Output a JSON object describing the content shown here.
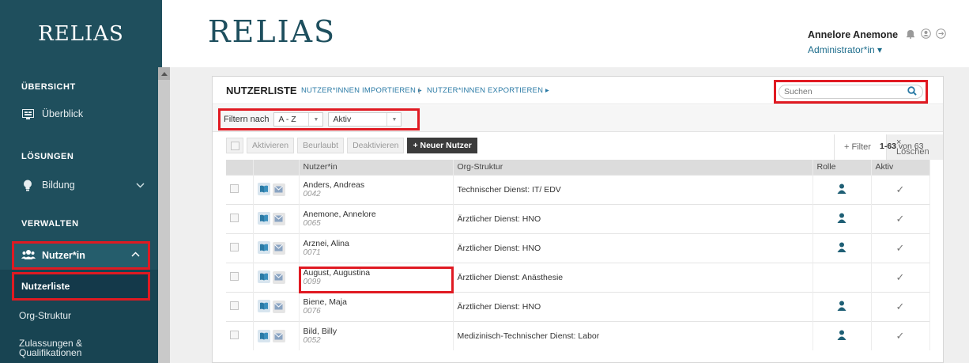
{
  "sidebar": {
    "logo": "RELIAS",
    "sections": {
      "overview": "ÜBERSICHT",
      "solutions": "LÖSUNGEN",
      "manage": "VERWALTEN"
    },
    "items": {
      "overview": "Überblick",
      "education": "Bildung",
      "users": "Nutzer*in"
    },
    "sub_items": {
      "userlist": "Nutzerliste",
      "org": "Org-Struktur",
      "certs_line1": "Zulassungen &",
      "certs_line2": "Qualifikationen"
    }
  },
  "topbar": {
    "logo": "RELIAS",
    "user_name": "Annelore Anemone",
    "user_role": "Administrator*in ▾"
  },
  "panel": {
    "title": "NUTZERLISTE",
    "import_link": "NUTZER*INNEN IMPORTIEREN ▸",
    "separator": "|",
    "export_link": "NUTZER*INNEN EXPORTIEREN ▸",
    "search_placeholder": "Suchen",
    "filter_label": "Filtern nach",
    "filter_alpha": "A - Z",
    "filter_status": "Aktiv",
    "add_filter": "+ Filter",
    "clear": "× Löschen",
    "actions": {
      "activate": "Aktivieren",
      "leave": "Beurlaubt",
      "deactivate": "Deaktivieren",
      "new_user": "+ Neuer Nutzer"
    },
    "count_range": "1-63",
    "count_suffix": " von 63"
  },
  "table": {
    "headers": {
      "user": "Nutzer*in",
      "org": "Org-Struktur",
      "role": "Rolle",
      "active": "Aktiv"
    },
    "rows": [
      {
        "name": "Anders, Andreas",
        "id": "0042",
        "org": "Technischer Dienst: IT/ EDV",
        "role": true
      },
      {
        "name": "Anemone, Annelore",
        "id": "0065",
        "org": "Ärztlicher Dienst: HNO",
        "role": true
      },
      {
        "name": "Arznei, Alina",
        "id": "0071",
        "org": "Ärztlicher Dienst: HNO",
        "role": true
      },
      {
        "name": "August, Augustina",
        "id": "0099",
        "org": "Ärztlicher Dienst: Anästhesie",
        "role": false
      },
      {
        "name": "Biene, Maja",
        "id": "0076",
        "org": "Ärztlicher Dienst: HNO",
        "role": true
      },
      {
        "name": "Bild, Billy",
        "id": "0052",
        "org": "Medizinisch-Technischer Dienst: Labor",
        "role": true
      }
    ],
    "check_glyph": "✓"
  },
  "colors": {
    "sidebar": "#1f4f5d",
    "highlight": "#e01a22",
    "link": "#2a7aa5"
  }
}
